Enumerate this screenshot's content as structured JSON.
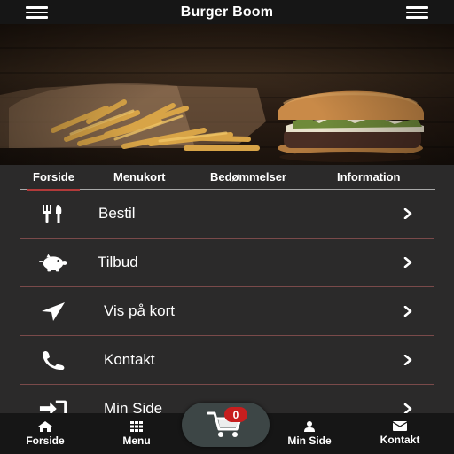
{
  "app": {
    "title": "Burger Boom"
  },
  "colors": {
    "accent": "#b23a3a",
    "badge": "#c81e1e",
    "bar": "#161616",
    "background": "#2b2a2a"
  },
  "tabs": [
    {
      "label": "Forside",
      "active": true
    },
    {
      "label": "Menukort",
      "active": false
    },
    {
      "label": "Bedømmelser",
      "active": false
    },
    {
      "label": "Information",
      "active": false
    }
  ],
  "menu_items": [
    {
      "label": "Bestil",
      "icon": "fork-knife-icon"
    },
    {
      "label": "Tilbud",
      "icon": "piggy-bank-icon"
    },
    {
      "label": "Vis på kort",
      "icon": "location-arrow-icon"
    },
    {
      "label": "Kontakt",
      "icon": "phone-icon"
    },
    {
      "label": "Min Side",
      "icon": "sign-in-icon"
    }
  ],
  "bottom_nav": [
    {
      "label": "Forside",
      "icon": "home-icon"
    },
    {
      "label": "Menu",
      "icon": "grid-icon"
    },
    {
      "label": "Min Side",
      "icon": "user-icon"
    },
    {
      "label": "Kontakt",
      "icon": "envelope-icon"
    }
  ],
  "cart": {
    "count": "0",
    "icon": "cart-icon"
  }
}
